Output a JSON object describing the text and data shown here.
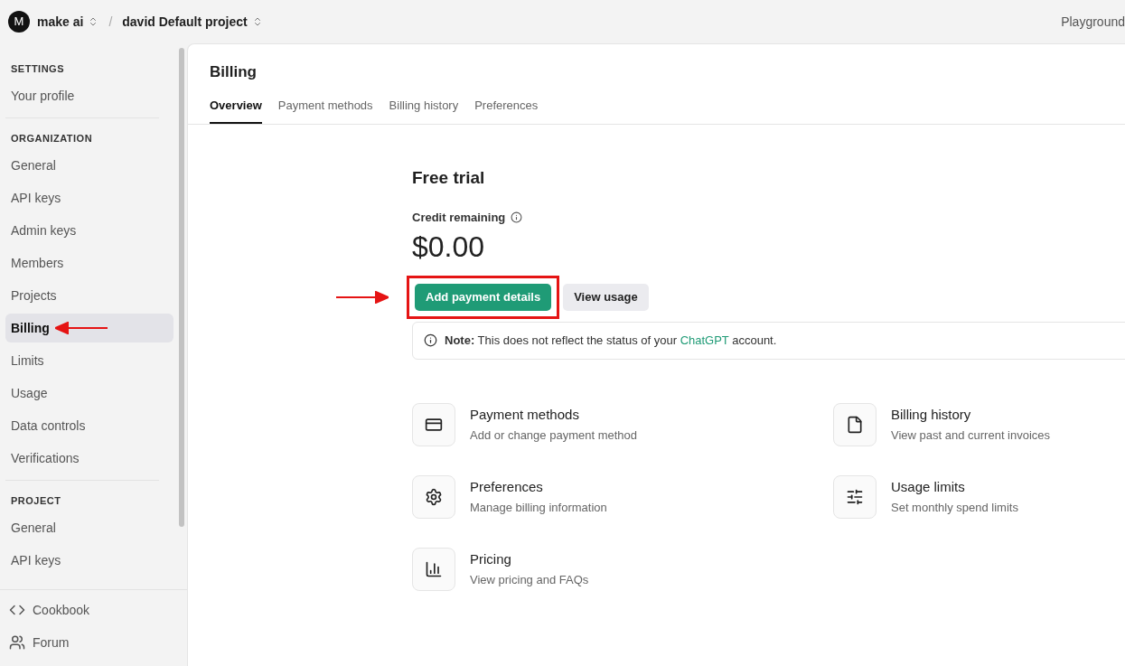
{
  "topbar": {
    "avatar": "M",
    "organization": "make ai",
    "separator": "/",
    "project": "david Default project",
    "right_link": "Playground"
  },
  "sidebar": {
    "sections": [
      {
        "heading": "SETTINGS",
        "items": [
          {
            "label": "Your profile",
            "selected": false
          }
        ]
      },
      {
        "heading": "ORGANIZATION",
        "items": [
          {
            "label": "General",
            "selected": false
          },
          {
            "label": "API keys",
            "selected": false
          },
          {
            "label": "Admin keys",
            "selected": false
          },
          {
            "label": "Members",
            "selected": false
          },
          {
            "label": "Projects",
            "selected": false
          },
          {
            "label": "Billing",
            "selected": true
          },
          {
            "label": "Limits",
            "selected": false
          },
          {
            "label": "Usage",
            "selected": false
          },
          {
            "label": "Data controls",
            "selected": false
          },
          {
            "label": "Verifications",
            "selected": false
          }
        ]
      },
      {
        "heading": "PROJECT",
        "items": [
          {
            "label": "General",
            "selected": false
          },
          {
            "label": "API keys",
            "selected": false
          }
        ]
      }
    ],
    "footer": [
      {
        "kind": "code",
        "label": "Cookbook"
      },
      {
        "kind": "people",
        "label": "Forum"
      }
    ]
  },
  "page": {
    "title": "Billing",
    "tabs": [
      {
        "label": "Overview",
        "selected": true
      },
      {
        "label": "Payment methods",
        "selected": false
      },
      {
        "label": "Billing history",
        "selected": false
      },
      {
        "label": "Preferences",
        "selected": false
      }
    ]
  },
  "plan": {
    "title": "Free trial",
    "credit_label": "Credit remaining",
    "credit": "$0.00",
    "primary_button": "Add payment details",
    "secondary_button": "View usage"
  },
  "note": {
    "label": "Note:",
    "text_before": "This does not reflect the status of your",
    "link": "ChatGPT",
    "text_after": "account."
  },
  "cards": [
    {
      "kind": "card",
      "title": "Payment methods",
      "subtitle": "Add or change payment method"
    },
    {
      "kind": "file",
      "title": "Billing history",
      "subtitle": "View past and current invoices"
    },
    {
      "kind": "gear",
      "title": "Preferences",
      "subtitle": "Manage billing information"
    },
    {
      "kind": "sliders",
      "title": "Usage limits",
      "subtitle": "Set monthly spend limits"
    },
    {
      "kind": "chart",
      "title": "Pricing",
      "subtitle": "View pricing and FAQs"
    }
  ]
}
